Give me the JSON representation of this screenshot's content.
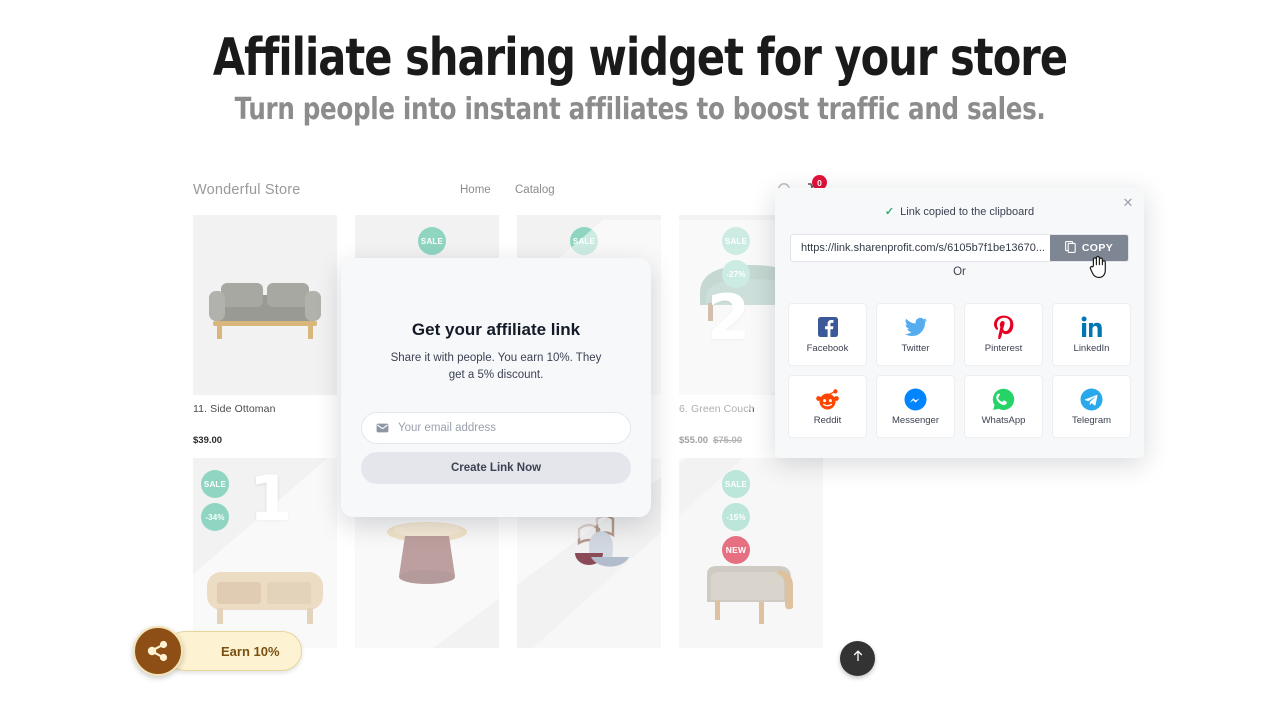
{
  "hero": {
    "title": "Affiliate sharing widget for your store",
    "subtitle": "Turn people into instant affiliates to boost traffic and sales."
  },
  "store": {
    "logo": "Wonderful Store",
    "nav": [
      {
        "label": "Home"
      },
      {
        "label": "Catalog"
      }
    ],
    "cart_count": "0",
    "icons": {
      "search": "search-icon",
      "cart": "cart-icon"
    },
    "products": [
      {
        "title": "11. Side Ottoman",
        "price": "$39.00",
        "old_price": "",
        "badges": [],
        "rank": "",
        "image": "gray-sofa"
      },
      {
        "title": "",
        "price": "",
        "old_price": "",
        "badges": [
          "SALE"
        ],
        "rank": "",
        "image": "product-placeholder"
      },
      {
        "title": "",
        "price": "",
        "old_price": "",
        "badges": [
          "SALE"
        ],
        "rank": "",
        "image": "product-placeholder"
      },
      {
        "title": "6. Green Couch",
        "price": "$55.00",
        "old_price": "$75.00",
        "badges": [
          "SALE",
          "-27%"
        ],
        "rank": "2",
        "image": "green-couch"
      },
      {
        "title": "",
        "price": "",
        "old_price": "",
        "badges": [
          "SALE",
          "-34%"
        ],
        "rank": "1",
        "image": "wood-sideboard"
      },
      {
        "title": "",
        "price": "",
        "old_price": "",
        "badges": [],
        "rank": "",
        "image": "round-side-table"
      },
      {
        "title": "",
        "price": "",
        "old_price": "",
        "badges": [],
        "rank": "",
        "image": "decor-vessels"
      },
      {
        "title": "",
        "price": "",
        "old_price": "",
        "badges": [
          "SALE",
          "-15%",
          "NEW"
        ],
        "rank": "",
        "image": "beige-ottoman"
      }
    ],
    "colors": {
      "sale_badge": "#8fd5c2",
      "new_badge": "#d81030",
      "cart_badge": "#e2113a"
    }
  },
  "earn_button": {
    "label": "Earn 10%",
    "icon": "share-nodes-icon",
    "circle_color": "#8d4f15",
    "pill_color": "#fdf3d2"
  },
  "scroll_top": {
    "icon": "arrow-up-icon"
  },
  "affiliate_modal": {
    "title": "Get your affiliate link",
    "description": "Share it with people. You earn 10%. They get a 5% discount.",
    "email_placeholder": "Your email address",
    "email_value": "",
    "email_icon": "envelope-icon",
    "submit_label": "Create Link Now"
  },
  "share_popup": {
    "status": "Link copied to the clipboard",
    "status_icon": "check-icon",
    "close_icon": "close-icon",
    "link_value": "https://link.sharenprofit.com/s/6105b7f1be13670...",
    "copy_label": "COPY",
    "copy_icon": "clipboard-icon",
    "divider": "Or",
    "socials": [
      {
        "label": "Facebook",
        "icon": "facebook-icon",
        "color": "#3b5998"
      },
      {
        "label": "Twitter",
        "icon": "twitter-icon",
        "color": "#55acee"
      },
      {
        "label": "Pinterest",
        "icon": "pinterest-icon",
        "color": "#e60023"
      },
      {
        "label": "LinkedIn",
        "icon": "linkedin-icon",
        "color": "#0077b5"
      },
      {
        "label": "Reddit",
        "icon": "reddit-icon",
        "color": "#ff4500"
      },
      {
        "label": "Messenger",
        "icon": "messenger-icon",
        "color": "#0084ff"
      },
      {
        "label": "WhatsApp",
        "icon": "whatsapp-icon",
        "color": "#25d366"
      },
      {
        "label": "Telegram",
        "icon": "telegram-icon",
        "color": "#29a9eb"
      }
    ]
  }
}
